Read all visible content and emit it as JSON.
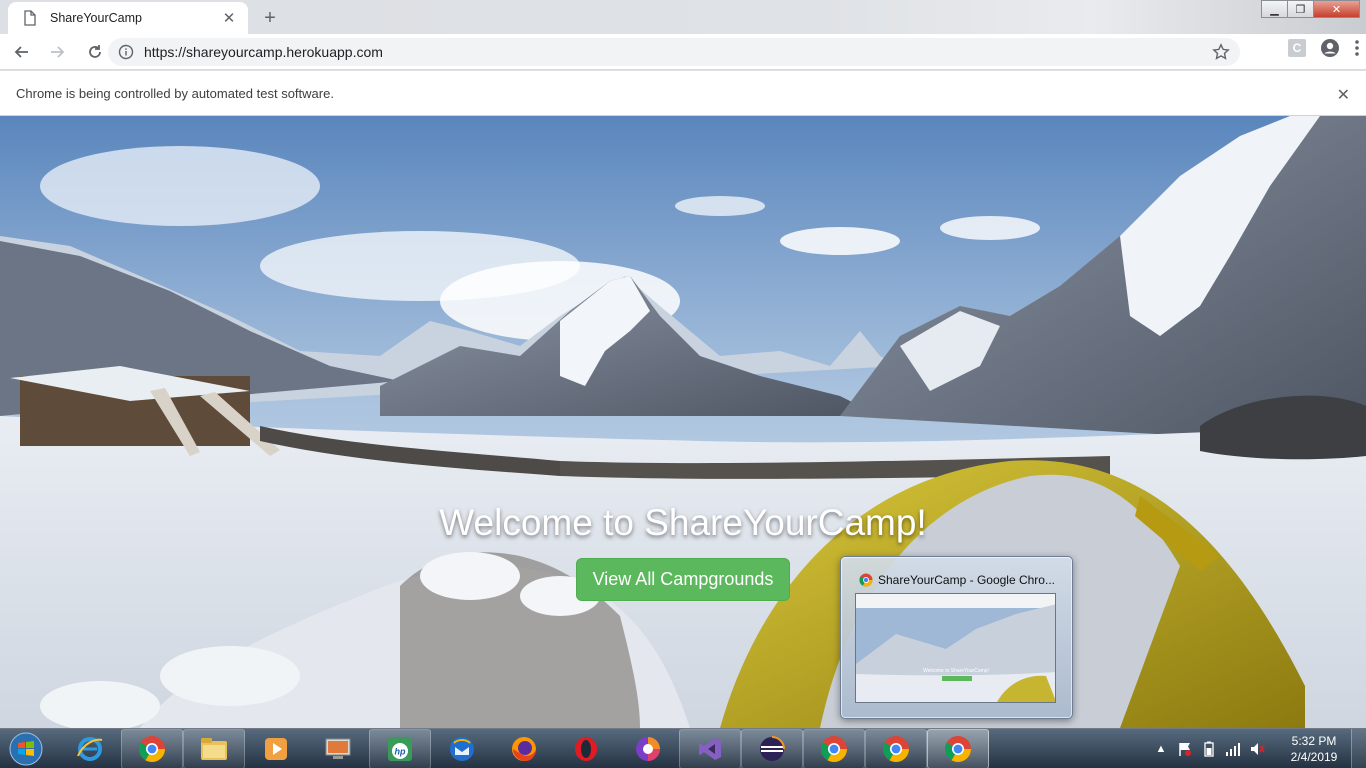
{
  "browser": {
    "tab_title": "ShareYourCamp",
    "url": "https://shareyourcamp.herokuapp.com",
    "infobar_message": "Chrome is being controlled by automated test software."
  },
  "page": {
    "heading": "Welcome to ShareYourCamp!",
    "cta_label": "View All Campgrounds",
    "cta_color": "#5cb85c"
  },
  "taskbar": {
    "preview_title": "ShareYourCamp - Google Chro...",
    "preview_heading": "Welcome to ShareYourCamp!",
    "apps": [
      "internet-explorer",
      "chrome",
      "file-explorer",
      "media-player",
      "remote-desktop",
      "hp-app",
      "thunderbird",
      "firefox",
      "opera",
      "app-circle",
      "visual-studio",
      "eclipse",
      "chrome",
      "chrome",
      "chrome"
    ],
    "clock_time": "5:32 PM",
    "clock_date": "2/4/2019"
  }
}
